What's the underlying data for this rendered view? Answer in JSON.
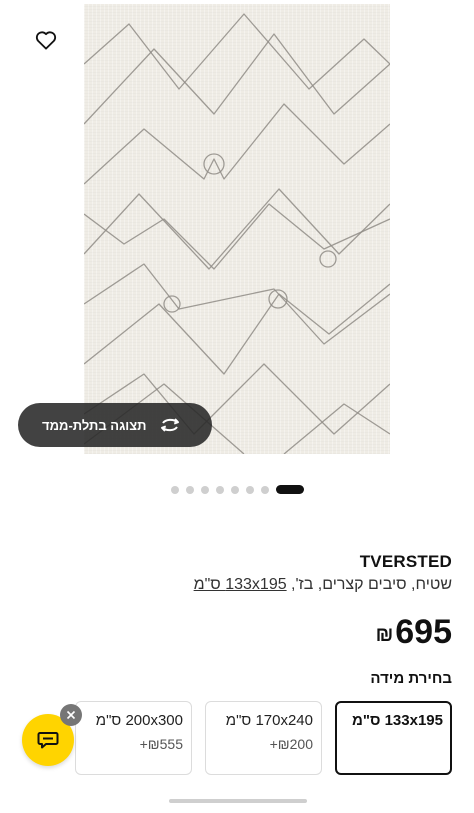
{
  "product": {
    "name": "TVERSTED",
    "description": "שטיח, סיבים קצרים, בז', ",
    "size_link": "133x195 ס\"מ",
    "price": "695",
    "currency": "₪"
  },
  "actions": {
    "view_3d_label": "תצוגה בתלת-ממד",
    "favorite_icon": "heart-icon",
    "view_3d_icon": "rotate-3d-icon",
    "chat_icon": "chat-icon",
    "close_icon": "close-icon"
  },
  "gallery": {
    "total_images": 8,
    "active_index": 0
  },
  "size_selection": {
    "title": "בחירת מידה",
    "options": [
      {
        "label": "133x195 ס\"מ",
        "extra": "",
        "selected": true
      },
      {
        "label": "170x240 ס\"מ",
        "extra": "₪200+",
        "selected": false
      },
      {
        "label": "200x300 ס\"מ",
        "extra": "₪555+",
        "selected": false
      }
    ]
  },
  "colors": {
    "accent": "#ffd400",
    "text": "#111111",
    "rug_base": "#efece5",
    "rug_lines": "#8f8c86"
  }
}
